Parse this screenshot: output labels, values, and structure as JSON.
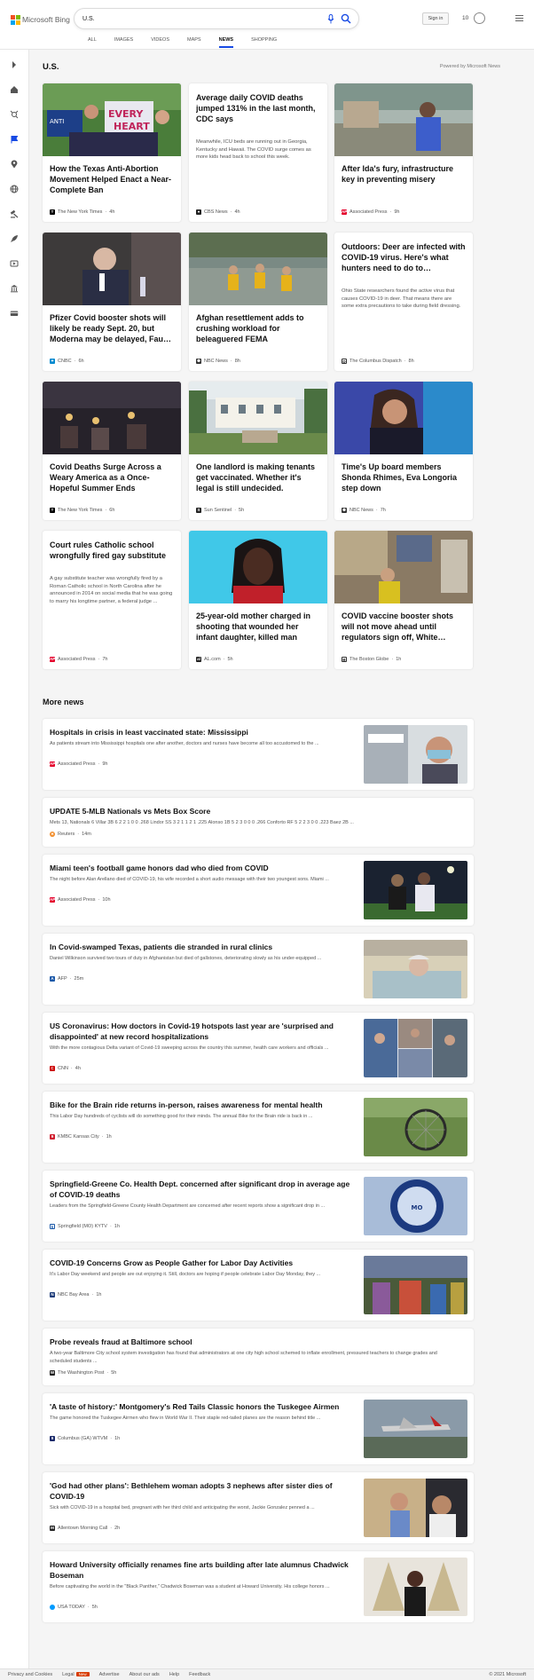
{
  "header": {
    "logo_text": "Microsoft Bing",
    "search_value": "U.S.",
    "signin_label": "Sign in",
    "points": "10",
    "tabs": [
      "ALL",
      "IMAGES",
      "VIDEOS",
      "MAPS",
      "NEWS",
      "SHOPPING"
    ],
    "active_tab": "NEWS"
  },
  "section": {
    "title": "U.S.",
    "powered_by": "Powered by Microsoft News"
  },
  "cards": [
    {
      "title": "How the Texas Anti-Abortion Movement Helped Enact a Near-Complete Ban",
      "snippet": "",
      "source": "The New York Times",
      "time": "4h"
    },
    {
      "title": "Average daily COVID deaths jumped 131% in the last month, CDC says",
      "snippet": "Meanwhile, ICU beds are running out in Georgia, Kentucky and Hawaii. The COVID surge comes as more kids head back to school this week.",
      "source": "CBS News",
      "time": "4h"
    },
    {
      "title": "After Ida's fury, infrastructure key in preventing misery",
      "snippet": "",
      "source": "Associated Press",
      "time": "9h"
    },
    {
      "title": "Pfizer Covid booster shots will likely be ready Sept. 20, but Moderna may be delayed, Fau…",
      "snippet": "",
      "source": "CNBC",
      "time": "6h"
    },
    {
      "title": "Afghan resettlement adds to crushing workload for beleaguered FEMA",
      "snippet": "",
      "source": "NBC News",
      "time": "8h"
    },
    {
      "title": "Outdoors: Deer are infected with COVID-19 virus. Here's what hunters need to do to…",
      "snippet": "Ohio State researchers found the active virus that causes COVID-19 in deer. That means there are some extra precautions to take during field dressing.",
      "source": "The Columbus Dispatch",
      "time": "8h"
    },
    {
      "title": "Covid Deaths Surge Across a Weary America as a Once-Hopeful Summer Ends",
      "snippet": "",
      "source": "The New York Times",
      "time": "6h"
    },
    {
      "title": "One landlord is making tenants get vaccinated. Whether it's legal is still undecided.",
      "snippet": "",
      "source": "Sun Sentinel",
      "time": "5h"
    },
    {
      "title": "Time's Up board members Shonda Rhimes, Eva Longoria step down",
      "snippet": "",
      "source": "NBC News",
      "time": "7h"
    },
    {
      "title": "Court rules Catholic school wrongfully fired gay substitute",
      "snippet": "A gay substitute teacher was wrongfully fired by a Roman Catholic school in North Carolina after he announced in 2014 on social media that he was going to marry his longtime partner, a federal judge ...",
      "source": "Associated Press",
      "time": "7h"
    },
    {
      "title": "25-year-old mother charged in shooting that wounded her infant daughter, killed man",
      "snippet": "",
      "source": "AL.com",
      "time": "5h"
    },
    {
      "title": "COVID vaccine booster shots will not move ahead until regulators sign off, White…",
      "snippet": "",
      "source": "The Boston Globe",
      "time": "1h"
    }
  ],
  "more_news": {
    "title": "More news",
    "items": [
      {
        "title": "Hospitals in crisis in least vaccinated state: Mississippi",
        "snippet": "As patients stream into Mississippi hospitals one after another, doctors and nurses have become all too accustomed to the ...",
        "source": "Associated Press",
        "time": "9h"
      },
      {
        "title": "UPDATE 5-MLB Nationals vs Mets Box Score",
        "snippet": "Mets 13, Nationals 6 Villar 3B 6 2 2 1 0 0 .268 Lindor SS 3 2 1 1 2 1 .225 Alonso 1B 5 2 3 0 0 0 .266 Conforto RF 5 2 2 3 0 0 .223 Baez 2B ...",
        "source": "Reuters",
        "time": "14m"
      },
      {
        "title": "Miami teen's football game honors dad who died from COVID",
        "snippet": "The night before Alan Arellano died of COVID-19, his wife recorded a short audio message with their two youngest sons. Miami ...",
        "source": "Associated Press",
        "time": "10h"
      },
      {
        "title": "In Covid-swamped Texas, patients die stranded in rural clinics",
        "snippet": "Daniel Wilkinson survived two tours of duty in Afghanistan but died of gallstones, deteriorating slowly as his under-equipped ...",
        "source": "AFP",
        "time": "25m"
      },
      {
        "title": "US Coronavirus: How doctors in Covid-19 hotspots last year are 'surprised and disappointed' at new record hospitalizations",
        "snippet": "With the more contagious Delta variant of Covid-19 sweeping across the country this summer, health care workers and officials ...",
        "source": "CNN",
        "time": "4h"
      },
      {
        "title": "Bike for the Brain ride returns in-person, raises awareness for mental health",
        "snippet": "This Labor Day hundreds of cyclists will do something good for their minds. The annual Bike for the Brain ride is back in ...",
        "source": "KMBC Kansas City",
        "time": "1h"
      },
      {
        "title": "Springfield-Greene Co. Health Dept. concerned after significant drop in average age of COVID-19 deaths",
        "snippet": "Leaders from the Springfield-Greene County Health Department are concerned after recent reports show a significant drop in ...",
        "source": "Springfield (MO) KYTV",
        "time": "1h"
      },
      {
        "title": "COVID-19 Concerns Grow as People Gather for Labor Day Activities",
        "snippet": "It's Labor Day weekend and people are out enjoying it. Still, doctors are hoping if people celebrate Labor Day Monday, they ...",
        "source": "NBC Bay Area",
        "time": "1h"
      },
      {
        "title": "Probe reveals fraud at Baltimore school",
        "snippet": "A two-year Baltimore City school system investigation has found that administrators at one city high school schemed to inflate enrollment, pressured teachers to change grades and scheduled students ...",
        "source": "The Washington Post",
        "time": "5h"
      },
      {
        "title": "'A taste of history:' Montgomery's Red Tails Classic honors the Tuskegee Airmen",
        "snippet": "The game honored the Tuskegee Airmen who flew in World War II. Their staple red-tailed planes are the reason behind title ...",
        "source": "Columbus (GA) WTVM",
        "time": "1h"
      },
      {
        "title": "'God had other plans': Bethlehem woman adopts 3 nephews after sister dies of COVID-19",
        "snippet": "Sick with COVID-19 in a hospital bed, pregnant with her third child and anticipating the worst, Jackie Gonzalez penned a ...",
        "source": "Allentown Morning Call",
        "time": "2h"
      },
      {
        "title": "Howard University officially renames fine arts building after late alumnus Chadwick Boseman",
        "snippet": "Before captivating the world in the \"Black Panther,\" Chadwick Boseman was a student at Howard University. His college honors ...",
        "source": "USA TODAY",
        "time": "5h"
      }
    ]
  },
  "footer": {
    "links": [
      "Privacy and Cookies",
      "Legal",
      "Advertise",
      "About our ads",
      "Help",
      "Feedback"
    ],
    "new_badge": "New",
    "copyright": "© 2021 Microsoft"
  },
  "colors": {
    "accent": "#174ae4",
    "page_bg": "#f5f5f5"
  }
}
